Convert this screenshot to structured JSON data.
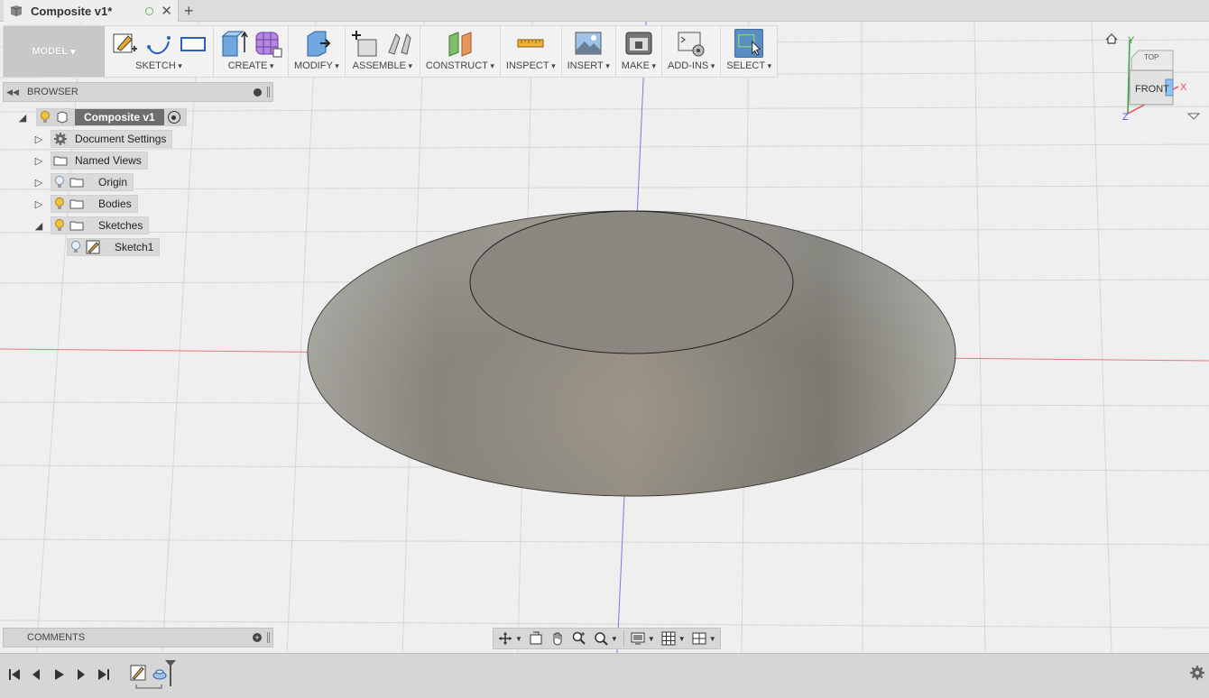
{
  "window": {
    "tab_title": "Composite v1*"
  },
  "toolbar": {
    "mode_label": "MODEL",
    "groups": [
      "SKETCH",
      "CREATE",
      "MODIFY",
      "ASSEMBLE",
      "CONSTRUCT",
      "INSPECT",
      "INSERT",
      "MAKE",
      "ADD-INS",
      "SELECT"
    ]
  },
  "browser": {
    "title": "BROWSER",
    "root": "Composite v1",
    "items": [
      "Document Settings",
      "Named Views",
      "Origin",
      "Bodies",
      "Sketches",
      "Sketch1"
    ]
  },
  "comments": {
    "title": "COMMENTS"
  },
  "viewcube": {
    "face": "FRONT",
    "top_face": "TOP",
    "axis_x": "X",
    "axis_y": "Y",
    "axis_z": "Z"
  },
  "colors": {
    "accent": "#5b8cc2",
    "bulb": "#f2c43a",
    "axis_red": "#e05050",
    "axis_blue": "#5050e0",
    "body_shade": "#8a8780"
  }
}
